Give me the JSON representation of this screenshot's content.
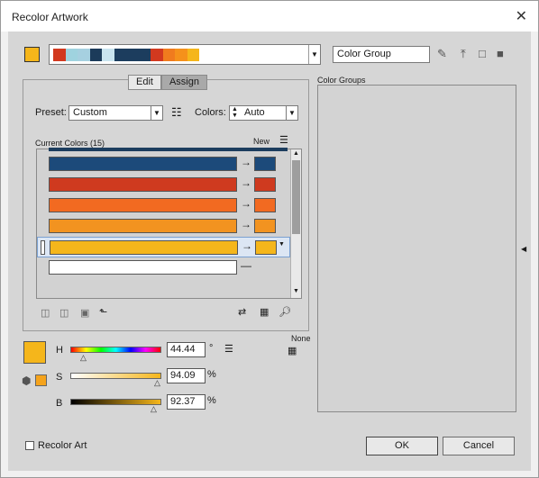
{
  "window": {
    "title": "Recolor Artwork",
    "close_icon": "✕"
  },
  "header": {
    "color_group_name": "Color Group",
    "strip_colors": [
      "#d2391f",
      "#9fd3df",
      "#a6d0e0",
      "#1c3b5a",
      "#c9e4ef",
      "#1c3d5e",
      "#1c3d5e",
      "#1c3d5e",
      "#d2391f",
      "#f07b1e",
      "#f5911b",
      "#f5b61b"
    ]
  },
  "tabs": {
    "edit": "Edit",
    "assign": "Assign"
  },
  "preset": {
    "label": "Preset:",
    "value": "Custom"
  },
  "colors": {
    "label": "Colors:",
    "value": "Auto"
  },
  "list": {
    "header": "Current Colors (15)",
    "new_header": "New",
    "rows": [
      {
        "current": "#1c4a7a",
        "new": "#1c4a7a"
      },
      {
        "current": "#cf3a1f",
        "new": "#cf3a1f"
      },
      {
        "current": "#f26a21",
        "new": "#f26a21"
      },
      {
        "current": "#f29320",
        "new": "#f29320"
      },
      {
        "current": "#f5b61b",
        "new": "#f5b61b"
      },
      {
        "current": "#ffffff",
        "new": ""
      }
    ]
  },
  "hsb": {
    "h_label": "H",
    "h_value": "44.44",
    "h_unit": "°",
    "s_label": "S",
    "s_value": "94.09",
    "s_unit": "%",
    "b_label": "B",
    "b_value": "92.37",
    "b_unit": "%",
    "none_label": "None"
  },
  "color_groups": {
    "label": "Color Groups"
  },
  "footer": {
    "recolor_art": "Recolor Art",
    "ok": "OK",
    "cancel": "Cancel"
  }
}
